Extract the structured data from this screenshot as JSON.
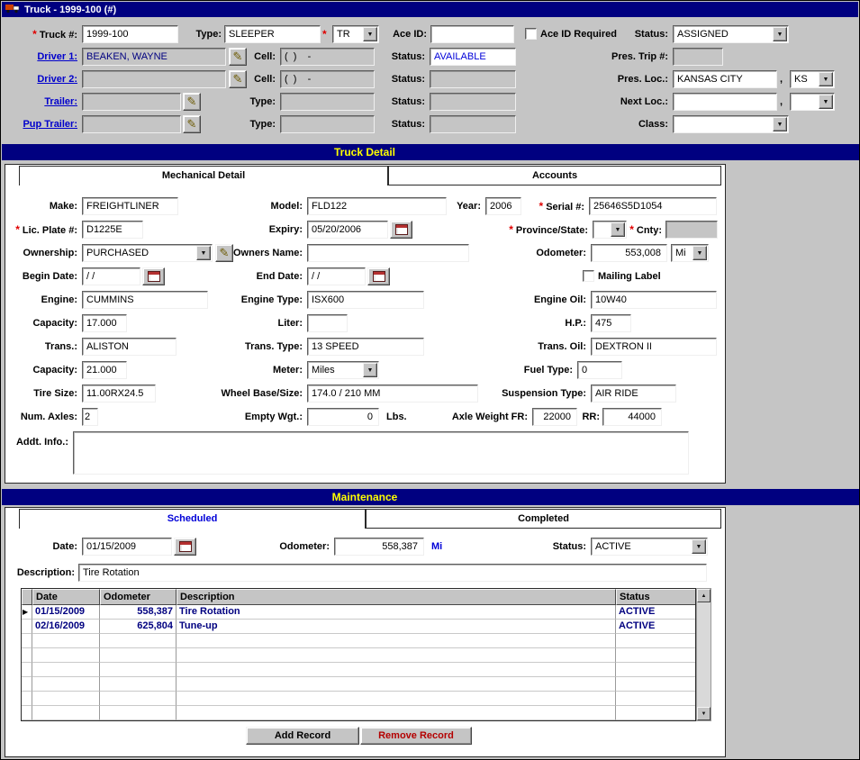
{
  "colors": {
    "titlebar": "#000080",
    "section_header_text": "#ffff00",
    "link": "#0000cc",
    "data_text": "#000080",
    "required": "#e00000",
    "remove_button_text": "#b40000"
  },
  "icons": {
    "pencil": "✎",
    "arrow": "▼",
    "up": "▲",
    "down": "▼",
    "marker": "▶",
    "required": "*"
  },
  "window": {
    "title": "Truck - 1999-100 (#)"
  },
  "top": {
    "truck_no_label": "Truck #:",
    "truck_no": "1999-100",
    "type_label": "Type:",
    "type": "SLEEPER",
    "type_code": "TR",
    "ace_id_label": "Ace ID:",
    "ace_id": "",
    "ace_required_label": "Ace ID Required",
    "status_label": "Status:",
    "status": "ASSIGNED",
    "driver1_label": "Driver 1:",
    "driver1": "BEAKEN, WAYNE",
    "cell_label": "Cell:",
    "driver1_cell": "(  )    -",
    "driver1_status": "AVAILABLE",
    "pres_trip_label": "Pres. Trip #:",
    "pres_trip": "",
    "driver2_label": "Driver 2:",
    "driver2": "",
    "driver2_cell": "(  )    -",
    "driver2_status": "",
    "pres_loc_label": "Pres. Loc.:",
    "pres_loc": "KANSAS CITY",
    "pres_loc_state": "KS",
    "trailer_label": "Trailer:",
    "trailer": "",
    "trailer_type": "",
    "trailer_status": "",
    "next_loc_label": "Next Loc.:",
    "next_loc": "",
    "next_loc_state": "",
    "pup_label": "Pup Trailer:",
    "pup": "",
    "pup_type": "",
    "pup_status": "",
    "class_label": "Class:",
    "class_value": "",
    "comma": ","
  },
  "detail": {
    "title": "Truck Detail",
    "tab_mechanical": "Mechanical Detail",
    "tab_accounts": "Accounts",
    "make_label": "Make:",
    "make": "FREIGHTLINER",
    "model_label": "Model:",
    "model": "FLD122",
    "year_label": "Year:",
    "year": "2006",
    "serial_label": "Serial #:",
    "serial": "25646S5D1054",
    "plate_label": "Lic. Plate #:",
    "plate": "D1225E",
    "expiry_label": "Expiry:",
    "expiry": "05/20/2006",
    "province_label": "Province/State:",
    "province": "",
    "cnty_label": "Cnty:",
    "cnty": "",
    "ownership_label": "Ownership:",
    "ownership": "PURCHASED",
    "owners_name_label": "Owners Name:",
    "owners_name": "",
    "odometer_label": "Odometer:",
    "odometer": "553,008",
    "odometer_unit": "Mi",
    "begin_label": "Begin Date:",
    "begin_date": "/ /",
    "end_label": "End Date:",
    "end_date": "/ /",
    "mailing_label": "Mailing Label",
    "engine_label": "Engine:",
    "engine": "CUMMINS",
    "engine_type_label": "Engine Type:",
    "engine_type": "ISX600",
    "engine_oil_label": "Engine Oil:",
    "engine_oil": "10W40",
    "capacity1_label": "Capacity:",
    "capacity1": "17.000",
    "liter_label": "Liter:",
    "liter": "",
    "hp_label": "H.P.:",
    "hp": "475",
    "trans_label": "Trans.:",
    "trans": "ALISTON",
    "trans_type_label": "Trans. Type:",
    "trans_type": "13 SPEED",
    "trans_oil_label": "Trans. Oil:",
    "trans_oil": "DEXTRON II",
    "capacity2_label": "Capacity:",
    "capacity2": "21.000",
    "meter_label": "Meter:",
    "meter": "Miles",
    "fuel_label": "Fuel Type:",
    "fuel": "0",
    "tire_label": "Tire Size:",
    "tire": "11.00RX24.5",
    "wheel_label": "Wheel Base/Size:",
    "wheel": "174.0 / 210 MM",
    "susp_label": "Suspension Type:",
    "susp": "AIR RIDE",
    "axles_label": "Num. Axles:",
    "axles": "2",
    "empty_wgt_label": "Empty Wgt.:",
    "empty_wgt": "0",
    "empty_wgt_unit": "Lbs.",
    "axle_fr_label": "Axle Weight FR:",
    "axle_fr": "22000",
    "axle_rr_label": "RR:",
    "axle_rr": "44000",
    "addt_label": "Addt. Info.:",
    "addt": ""
  },
  "maintenance": {
    "title": "Maintenance",
    "tab_scheduled": "Scheduled",
    "tab_completed": "Completed",
    "date_label": "Date:",
    "date": "01/15/2009",
    "odometer_label": "Odometer:",
    "odometer": "558,387",
    "odometer_unit": "Mi",
    "status_label": "Status:",
    "status": "ACTIVE",
    "desc_label": "Description:",
    "desc": "Tire Rotation",
    "table": {
      "headers": [
        "Date",
        "Odometer",
        "Description",
        "Status"
      ],
      "rows": [
        {
          "date": "01/15/2009",
          "odometer": "558,387",
          "description": "Tire Rotation",
          "status": "ACTIVE"
        },
        {
          "date": "02/16/2009",
          "odometer": "625,804",
          "description": "Tune-up",
          "status": "ACTIVE"
        }
      ]
    },
    "add_button": "Add Record",
    "remove_button": "Remove Record"
  }
}
